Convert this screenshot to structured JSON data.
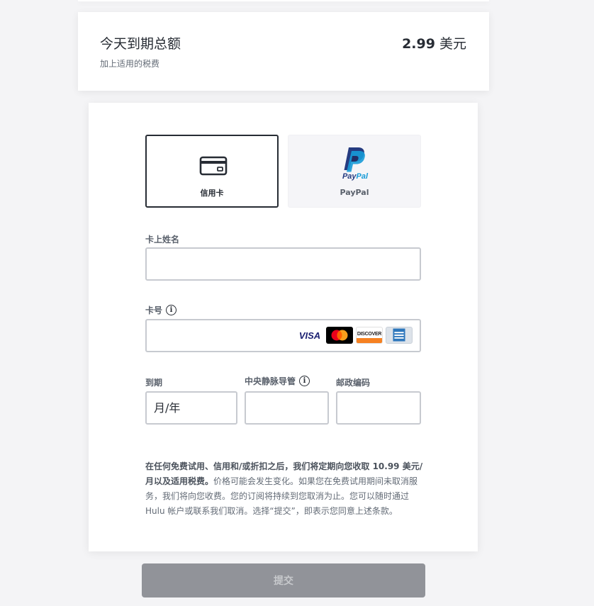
{
  "summary": {
    "title": "今天到期总额",
    "amount_value": "2.99",
    "amount_currency": " 美元",
    "subtitle": "加上适用的税费"
  },
  "payment_methods": {
    "credit_card_label": "信用卡",
    "paypal_label": "PayPal",
    "paypal_logo_text": "PayPal",
    "selected": "credit_card"
  },
  "fields": {
    "name_label": "卡上姓名",
    "name_value": "",
    "card_number_label": "卡号",
    "card_number_value": "",
    "card_brands": [
      "VISA",
      "mastercard",
      "DISCOVER",
      "AMERICAN EXPRESS"
    ],
    "expiry_label": "到期",
    "expiry_placeholder": "月/年",
    "cvv_label": "中央静脉导管",
    "cvv_value": "",
    "zip_label": "邮政编码",
    "zip_value": ""
  },
  "disclaimer": {
    "bold": "在任何免费试用、信用和/或折扣之后，我们将定期向您收取 10.99 美元/月以及适用税费。",
    "rest": "价格可能会发生变化。如果您在免费试用期间未取消服务，我们将向您收费。您的订阅将持续到您取消为止。您可以随时通过 Hulu 帐户或联系我们取消。选择“提交”，即表示您同意上述条款。"
  },
  "submit_label": "提交",
  "colors": {
    "dark": "#272c34",
    "border": "#c7cad0",
    "submit_disabled": "#919399",
    "paypal_dark_blue": "#253b80",
    "paypal_light_blue": "#179bd7"
  }
}
